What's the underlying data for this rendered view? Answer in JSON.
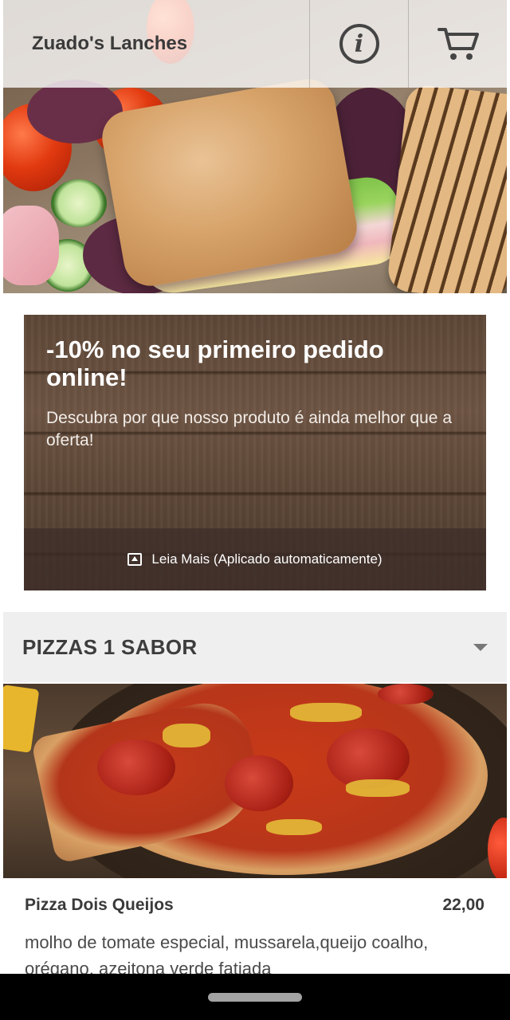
{
  "header": {
    "title": "Zuado's Lanches",
    "info_icon": "info-circle-icon",
    "cart_icon": "shopping-cart-icon"
  },
  "promo": {
    "title": "-10% no seu primeiro pedido online!",
    "description": "Descubra por que nosso produto é ainda melhor que a oferta!",
    "read_more": "Leia Mais (Aplicado automaticamente)",
    "read_more_icon": "expand-up-icon"
  },
  "category": {
    "title": "PIZZAS 1 SABOR",
    "toggle_icon": "caret-down-icon"
  },
  "products": [
    {
      "name": "Pizza Dois Queijos",
      "price": "22,00",
      "description": "molho de tomate especial, mussarela,queijo coalho, orégano, azeitona verde fatiada"
    }
  ],
  "colors": {
    "header_bg": "#ffffff",
    "category_bg": "#efefef",
    "text_dark": "#3a3a3a",
    "promo_text": "#ffffff"
  }
}
